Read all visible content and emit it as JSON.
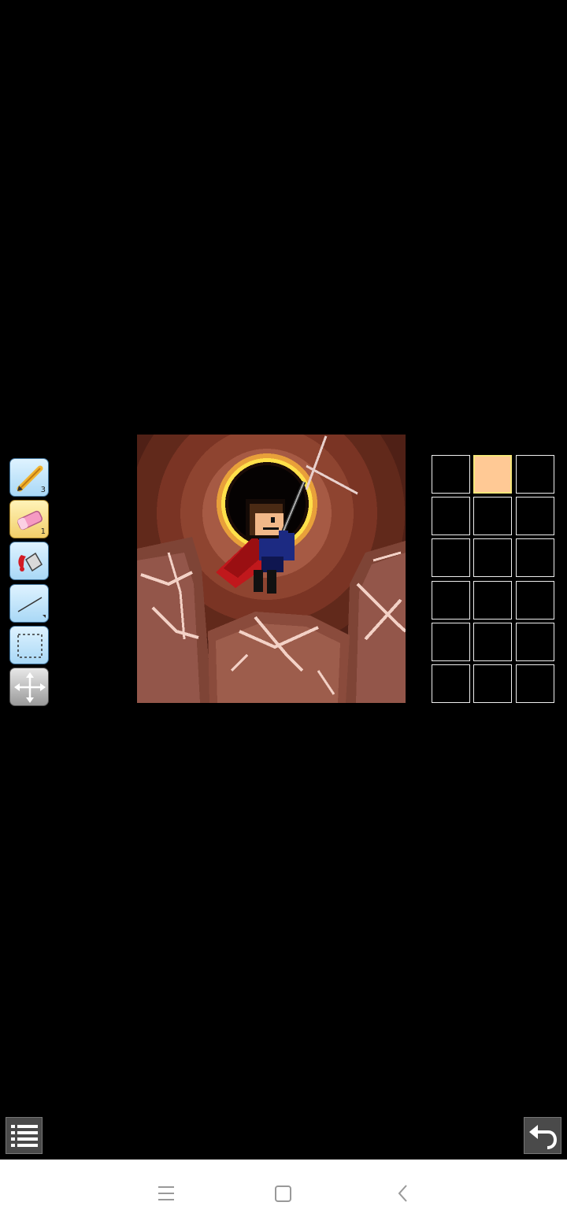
{
  "tools": [
    {
      "name": "pencil",
      "icon": "pencil-icon",
      "badge": "3"
    },
    {
      "name": "eraser",
      "icon": "eraser-icon",
      "badge": "1",
      "active": true
    },
    {
      "name": "fill",
      "icon": "paint-bucket-icon"
    },
    {
      "name": "line",
      "icon": "line-icon"
    },
    {
      "name": "select",
      "icon": "selection-rect-icon"
    },
    {
      "name": "move",
      "icon": "move-arrows-icon"
    }
  ],
  "palette": {
    "rows": 6,
    "cols": 3,
    "selected_index": 1,
    "colors": [
      "#000000",
      "#ffc995",
      "#000000",
      "#000000",
      "#000000",
      "#000000",
      "#000000",
      "#000000",
      "#000000",
      "#000000",
      "#000000",
      "#000000",
      "#000000",
      "#000000",
      "#000000",
      "#000000",
      "#000000",
      "#000000"
    ]
  },
  "colors": {
    "background": "#000000",
    "tool_blue": "#a9d8f6",
    "tool_active": "#f2cf6a",
    "selected_swatch_border": "#f5e67a"
  },
  "bottom": {
    "menu_icon": "list-menu-icon",
    "undo_icon": "undo-icon"
  },
  "navbar": {
    "icons": [
      "recent-apps-icon",
      "home-icon",
      "back-icon"
    ]
  }
}
